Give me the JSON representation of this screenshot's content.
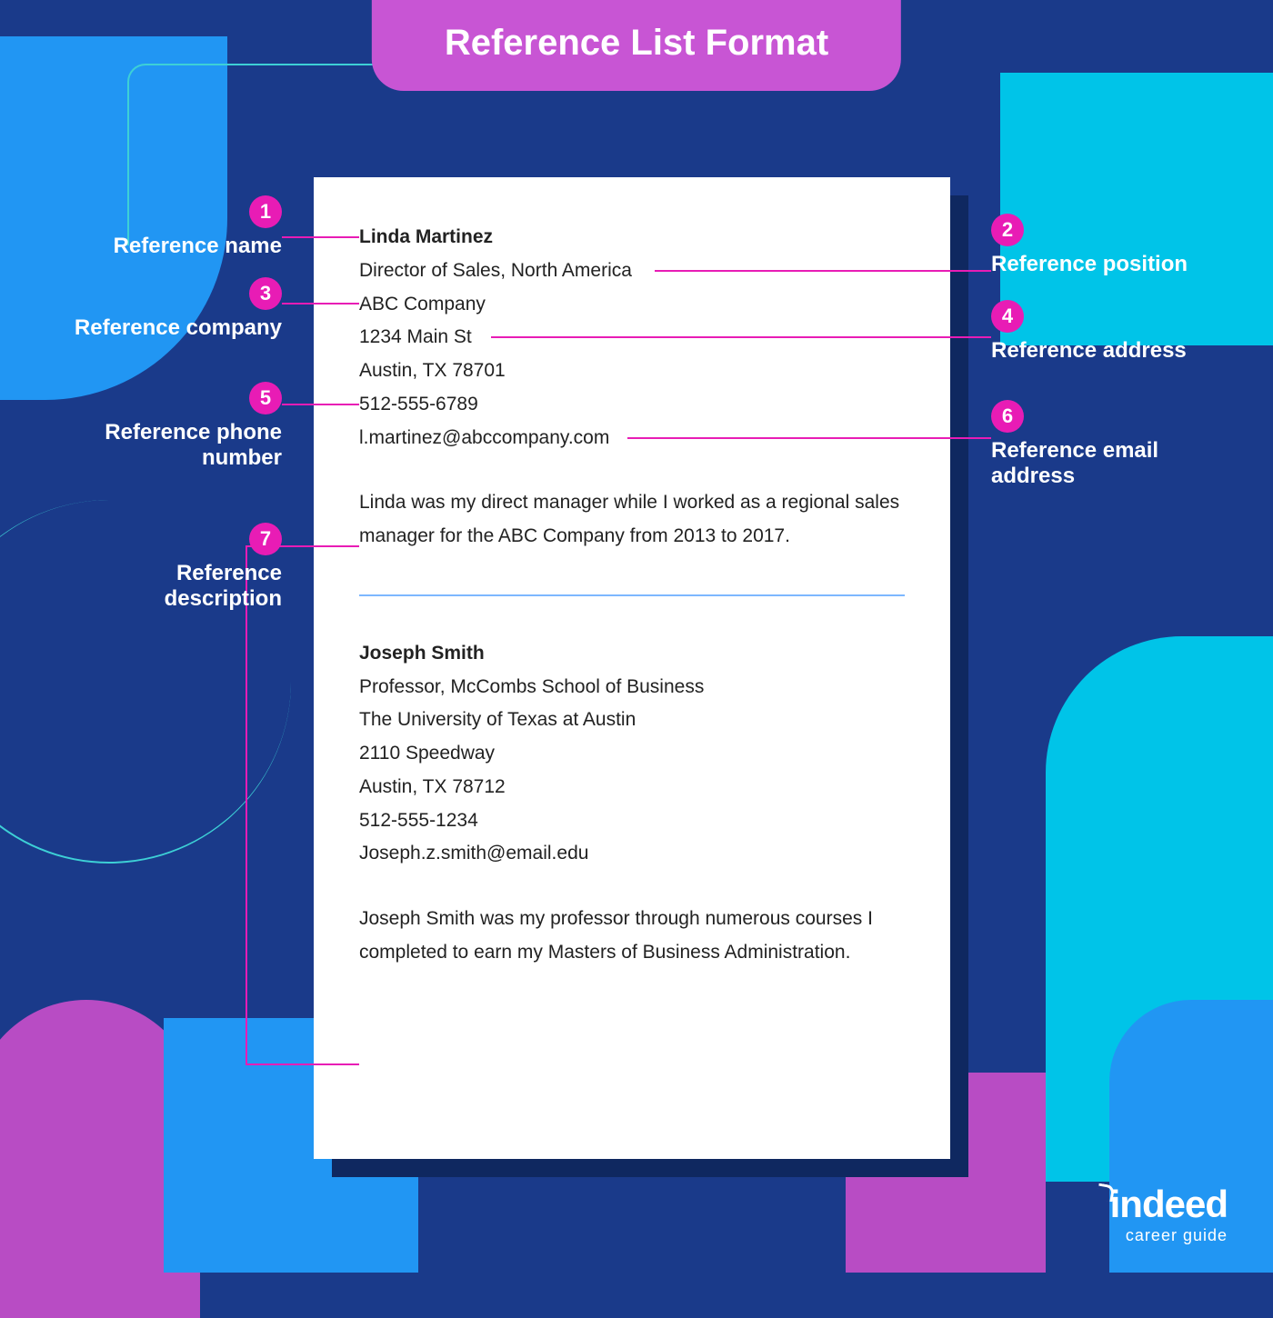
{
  "title": "Reference List Format",
  "callouts": [
    {
      "num": "1",
      "label": "Reference name"
    },
    {
      "num": "2",
      "label": "Reference position"
    },
    {
      "num": "3",
      "label": "Reference company"
    },
    {
      "num": "4",
      "label": "Reference address"
    },
    {
      "num": "5",
      "label": "Reference phone number"
    },
    {
      "num": "6",
      "label": "Reference email address"
    },
    {
      "num": "7",
      "label": "Reference description"
    }
  ],
  "references": [
    {
      "name": "Linda Martinez",
      "position": "Director of Sales, North America",
      "company": "ABC Company",
      "address_line1": "1234 Main St",
      "address_line2": "Austin, TX 78701",
      "phone": "512-555-6789",
      "email": "l.martinez@abccompany.com",
      "description": "Linda was my direct manager while I worked as a regional sales manager for the ABC Company from 2013 to 2017."
    },
    {
      "name": "Joseph Smith",
      "position": "Professor, McCombs School of Business",
      "company": "The University of Texas at Austin",
      "address_line1": "2110 Speedway",
      "address_line2": "Austin, TX 78712",
      "phone": "512-555-1234",
      "email": "Joseph.z.smith@email.edu",
      "description": "Joseph Smith was my professor through numerous courses I completed to earn my Masters of Business Administration."
    }
  ],
  "logo": {
    "brand": "indeed",
    "sub": "career guide"
  }
}
